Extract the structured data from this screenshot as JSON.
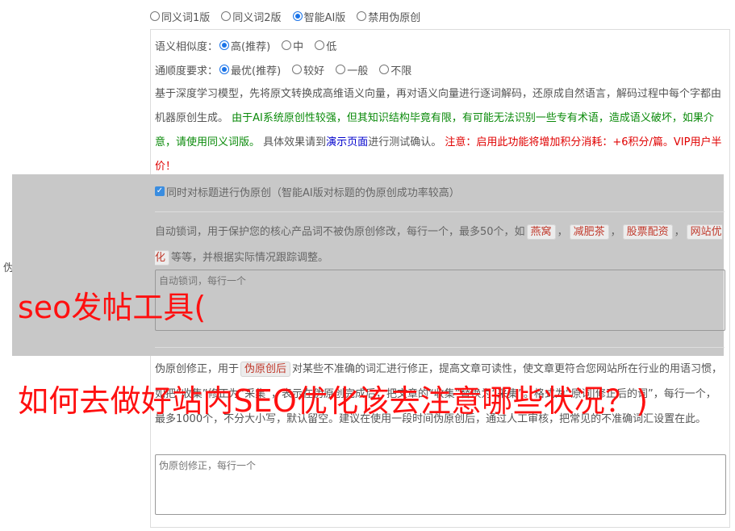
{
  "side_label": "伪原创设置",
  "modes": [
    {
      "label": "同义词1版",
      "checked": false
    },
    {
      "label": "同义词2版",
      "checked": false
    },
    {
      "label": "智能AI版",
      "checked": true
    },
    {
      "label": "禁用伪原创",
      "checked": false
    }
  ],
  "similarity": {
    "label": "语义相似度：",
    "options": [
      {
        "label": "高(推荐)",
        "checked": true
      },
      {
        "label": "中",
        "checked": false
      },
      {
        "label": "低",
        "checked": false
      }
    ]
  },
  "fluency": {
    "label": "通顺度要求：",
    "options": [
      {
        "label": "最优(推荐)",
        "checked": true
      },
      {
        "label": "较好",
        "checked": false
      },
      {
        "label": "一般",
        "checked": false
      },
      {
        "label": "不限",
        "checked": false
      }
    ]
  },
  "ai_desc": {
    "part1": "基于深度学习模型，先将原文转换成高维语义向量，再对语义向量进行逐词解码，还原成自然语言，解码过程中每个字都由机器原创生成。",
    "part2": "由于AI系统原创性较强，但其知识结构毕竟有限，有可能无法识别一些专有术语，造成语义破坏，如果介意，请使用同义词版。",
    "part3": "具体效果请到",
    "demo_link": "演示页面",
    "part4": "进行测试确认。",
    "part5": "注意：启用此功能将增加积分消耗：+6积分/篇。VIP用户半价！"
  },
  "title_checkbox": {
    "label": "同时对标题进行伪原创（智能AI版对标题的伪原创成功率较高）",
    "checked": true
  },
  "lock_words": {
    "desc_start": "自动锁词，用于保护您的核心产品词不被伪原创修改，每行一个，最多50个，如",
    "examples": [
      "燕窝",
      "减肥茶",
      "股票配资",
      "网站优化"
    ],
    "sep": "，",
    "desc_end": "等等，并根据实际情况跟踪调整。",
    "placeholder": "自动锁词，每行一个"
  },
  "correction": {
    "desc_start": "伪原创修正，用于",
    "tag": "伪原创后",
    "desc_rest": "对某些不准确的词汇进行修正，提高文章可读性，使文章更符合您网站所在行业的用语习惯，如把“收集”修正为“采集”，表示在伪原创完成后，把文章的“收集”替换为“采集”。格式为“原词|修正后的词”，每行一个，最多1000个，不分大小写，默认留空。建议在使用一段时间伪原创后，通过人工审核，把常见的不准确词汇设置在此。",
    "placeholder": "伪原创修正，每行一个"
  },
  "overlay_text": {
    "line1": "seo发帖工具(",
    "line2": "如何去做好站内SEO优化该去注意哪些状况？)"
  }
}
